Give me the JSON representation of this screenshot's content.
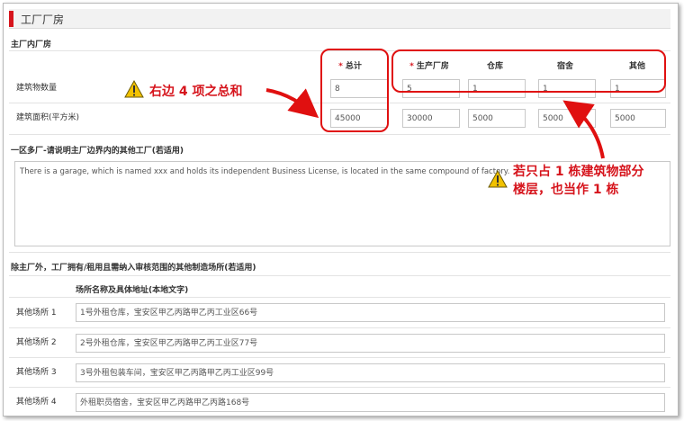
{
  "section": {
    "title": "工厂厂房"
  },
  "main_plant": {
    "label": "主厂内厂房",
    "columns": [
      {
        "label": "总计",
        "required": true
      },
      {
        "label": "生产厂房",
        "required": true
      },
      {
        "label": "仓库",
        "required": false
      },
      {
        "label": "宿舍",
        "required": false
      },
      {
        "label": "其他",
        "required": false
      }
    ],
    "rows": [
      {
        "label": "建筑物数量",
        "values": [
          "8",
          "5",
          "1",
          "1",
          "1"
        ]
      },
      {
        "label": "建筑面积(平方米)",
        "values": [
          "45000",
          "30000",
          "5000",
          "5000",
          "5000"
        ]
      }
    ]
  },
  "other_factories": {
    "label": "一区多厂-请说明主厂边界内的其他工厂(若适用)",
    "text": "There is a garage, which is named xxx and holds its independent Business License, is located in the same compound of factory."
  },
  "other_sites": {
    "label": "除主厂外，工厂拥有/租用且需纳入审核范围的其他制造场所(若适用)",
    "column_header": "场所名称及具体地址(本地文字)",
    "rows": [
      {
        "label": "其他场所 1",
        "value": "1号外租仓库，宝安区甲乙丙路甲乙丙工业区66号"
      },
      {
        "label": "其他场所 2",
        "value": "2号外租仓库，宝安区甲乙丙路甲乙丙工业区77号"
      },
      {
        "label": "其他场所 3",
        "value": "3号外租包装车间，宝安区甲乙丙路甲乙丙工业区99号"
      },
      {
        "label": "其他场所 4",
        "value": "外租职员宿舍，宝安区甲乙丙路甲乙丙路168号"
      }
    ]
  },
  "annotations": {
    "sum_note": "右边 4 项之总和",
    "partial_note_line1": "若只占 1 栋建筑物部分",
    "partial_note_line2": "楼层，也当作 1 栋"
  },
  "colors": {
    "accent": "#d6141c",
    "annotation": "#e01010",
    "warning": "#f2c200"
  }
}
